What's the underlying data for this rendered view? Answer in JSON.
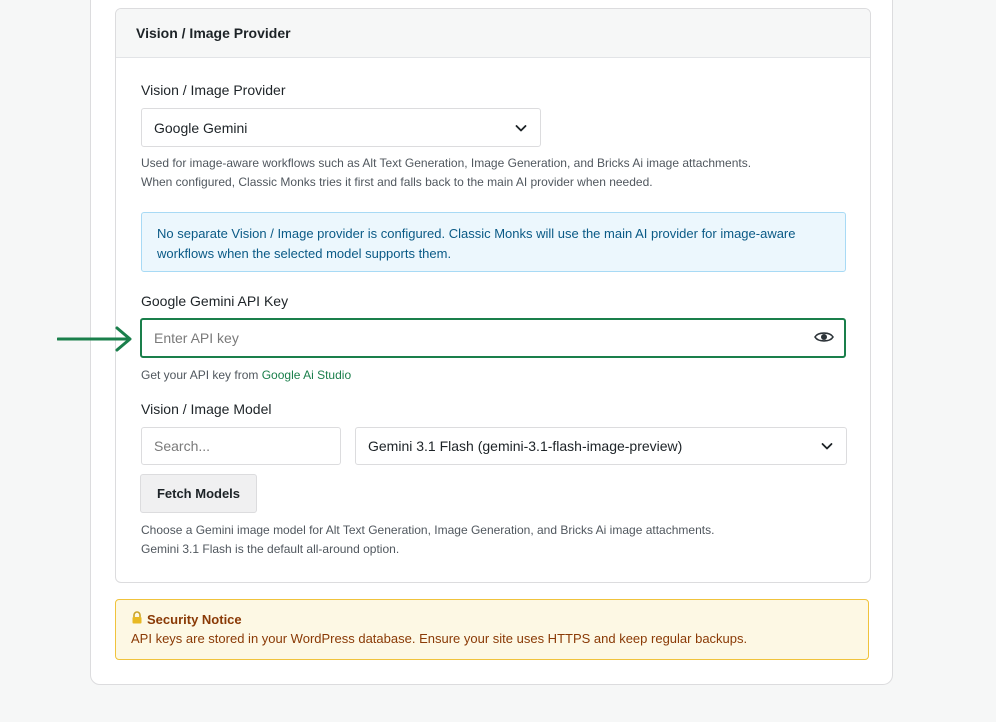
{
  "panel": {
    "title": "Vision / Image Provider"
  },
  "provider": {
    "label": "Vision / Image Provider",
    "selected": "Google Gemini",
    "help": "Used for image-aware workflows such as Alt Text Generation, Image Generation, and Bricks Ai image attachments. When configured, Classic Monks tries it first and falls back to the main AI provider when needed."
  },
  "info": {
    "text": "No separate Vision / Image provider is configured. Classic Monks will use the main AI provider for image-aware workflows when the selected model supports them."
  },
  "api_key": {
    "label": "Google Gemini API Key",
    "placeholder": "Enter API key",
    "help_prefix": "Get your API key from ",
    "help_link": "Google Ai Studio"
  },
  "model": {
    "label": "Vision / Image Model",
    "search_placeholder": "Search...",
    "selected": "Gemini 3.1 Flash (gemini-3.1-flash-image-preview)",
    "fetch_label": "Fetch Models",
    "help_line1": "Choose a Gemini image model for Alt Text Generation, Image Generation, and Bricks Ai image attachments.",
    "help_line2": "Gemini 3.1 Flash is the default all-around option."
  },
  "security": {
    "title": "Security Notice",
    "text": "API keys are stored in your WordPress database. Ensure your site uses HTTPS and keep regular backups."
  },
  "icons": {
    "chevron": "chevron-down-icon",
    "eye": "eye-icon",
    "lock": "lock-icon",
    "arrow": "arrow-right-icon"
  },
  "colors": {
    "accent_green": "#1a7f4b",
    "info_bg": "#ecf7fd",
    "info_text": "#0a5a86",
    "notice_bg": "#fdf8e4",
    "notice_border": "#f0c33c",
    "notice_text": "#8a3a06"
  }
}
